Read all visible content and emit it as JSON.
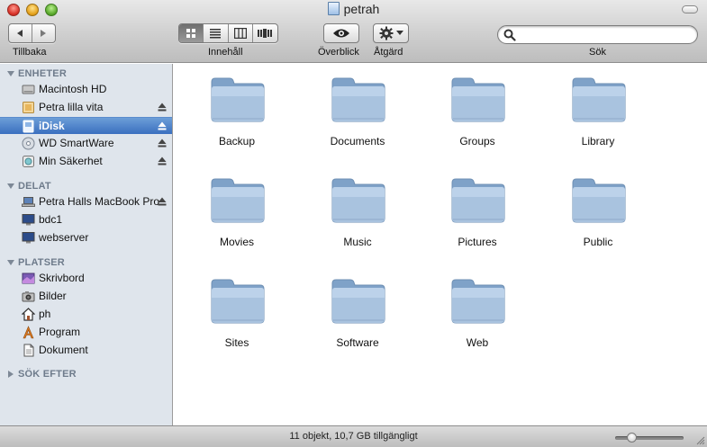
{
  "window": {
    "title": "petrah",
    "icon": "idisk-icon"
  },
  "toolbar": {
    "back_label": "Tillbaka",
    "view_label": "Innehåll",
    "quicklook_label": "Överblick",
    "action_label": "Åtgärd",
    "search_label": "Sök",
    "search_value": "",
    "search_placeholder": "",
    "active_view": "icon"
  },
  "sidebar": {
    "sections": [
      {
        "title": "ENHETER",
        "expanded": true,
        "items": [
          {
            "label": "Macintosh HD",
            "icon": "harddisk-icon",
            "eject": false,
            "selected": false
          },
          {
            "label": "Petra lilla vita",
            "icon": "external-disk-icon",
            "eject": true,
            "selected": false
          },
          {
            "label": "iDisk",
            "icon": "idisk-icon",
            "eject": true,
            "selected": true
          },
          {
            "label": "WD SmartWare",
            "icon": "cd-disk-icon",
            "eject": true,
            "selected": false
          },
          {
            "label": "Min Säkerhet",
            "icon": "drive-icon",
            "eject": true,
            "selected": false
          }
        ]
      },
      {
        "title": "DELAT",
        "expanded": true,
        "items": [
          {
            "label": "Petra Halls MacBook Pro",
            "icon": "laptop-icon",
            "eject": true,
            "selected": false
          },
          {
            "label": "bdc1",
            "icon": "monitor-icon",
            "eject": false,
            "selected": false
          },
          {
            "label": "webserver",
            "icon": "monitor-icon",
            "eject": false,
            "selected": false
          }
        ]
      },
      {
        "title": "PLATSER",
        "expanded": true,
        "items": [
          {
            "label": "Skrivbord",
            "icon": "desktop-icon",
            "eject": false,
            "selected": false
          },
          {
            "label": "Bilder",
            "icon": "camera-icon",
            "eject": false,
            "selected": false
          },
          {
            "label": "ph",
            "icon": "home-icon",
            "eject": false,
            "selected": false
          },
          {
            "label": "Program",
            "icon": "applications-icon",
            "eject": false,
            "selected": false
          },
          {
            "label": "Dokument",
            "icon": "document-icon",
            "eject": false,
            "selected": false
          }
        ]
      },
      {
        "title": "SÖK EFTER",
        "expanded": false,
        "items": []
      }
    ]
  },
  "folders": [
    {
      "label": "Backup"
    },
    {
      "label": "Documents"
    },
    {
      "label": "Groups"
    },
    {
      "label": "Library"
    },
    {
      "label": "Movies"
    },
    {
      "label": "Music"
    },
    {
      "label": "Pictures"
    },
    {
      "label": "Public"
    },
    {
      "label": "Sites"
    },
    {
      "label": "Software"
    },
    {
      "label": "Web"
    }
  ],
  "status": {
    "text": "11 objekt, 10,7 GB tillgängligt",
    "icon_size_level": 0.2
  },
  "colors": {
    "selection": "#3a6fbf",
    "sidebar_bg": "#dfe5ec",
    "folder": "#9cbad8"
  }
}
